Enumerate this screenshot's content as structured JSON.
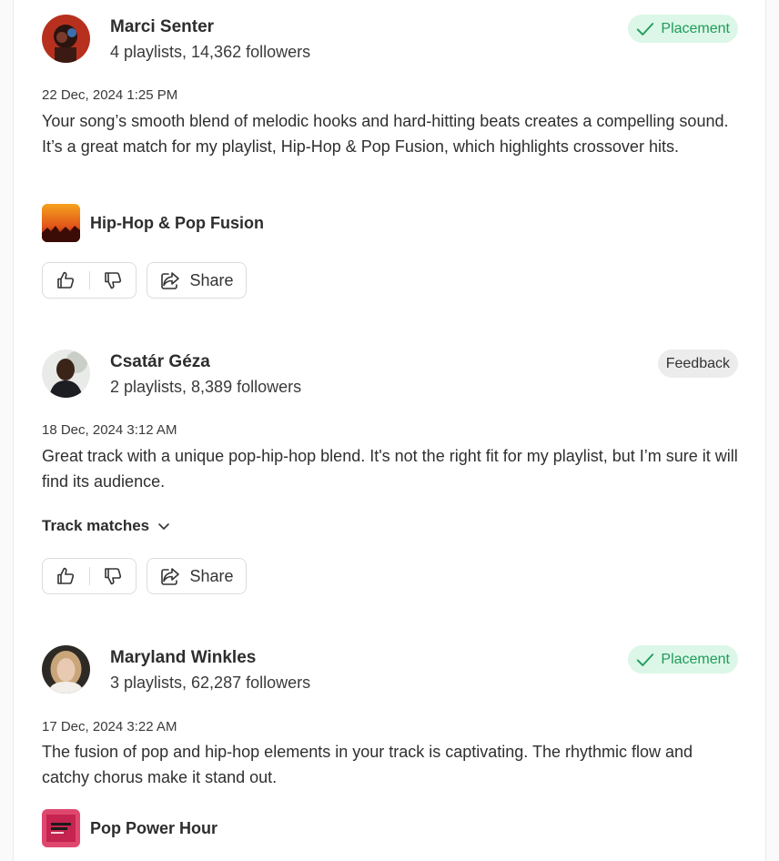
{
  "reviews": [
    {
      "curator": "Marci Senter",
      "stats": "4 playlists, 14,362 followers",
      "status": "Placement",
      "date": "22 Dec, 2024 1:25 PM",
      "text": "Your song’s smooth blend of melodic hooks and hard-hitting beats creates a compelling sound. It’s a great match for my playlist, Hip-Hop & Pop Fusion, which highlights crossover hits.",
      "playlist": "Hip-Hop & Pop Fusion",
      "share_label": "Share"
    },
    {
      "curator": "Csatár Géza",
      "stats": "2 playlists, 8,389 followers",
      "status": "Feedback",
      "date": "18 Dec, 2024 3:12 AM",
      "text": "Great track with a unique pop-hip-hop blend. It's not the right fit for my playlist, but I’m sure it will find its audience.",
      "track_matches_label": "Track matches",
      "share_label": "Share"
    },
    {
      "curator": "Maryland Winkles",
      "stats": "3 playlists, 62,287 followers",
      "status": "Placement",
      "date": "17 Dec, 2024 3:22 AM",
      "text": "The fusion of pop and hip-hop elements in your track is captivating. The rhythmic flow and catchy chorus make it stand out.",
      "playlist": "Pop Power Hour"
    }
  ],
  "colors": {
    "placement_bg": "#dcf7e7",
    "placement_text": "#1f9b5b",
    "feedback_bg": "#ececec"
  },
  "icons": [
    "checkmark-icon",
    "thumbs-up-icon",
    "thumbs-down-icon",
    "share-icon",
    "chevron-down-icon"
  ]
}
